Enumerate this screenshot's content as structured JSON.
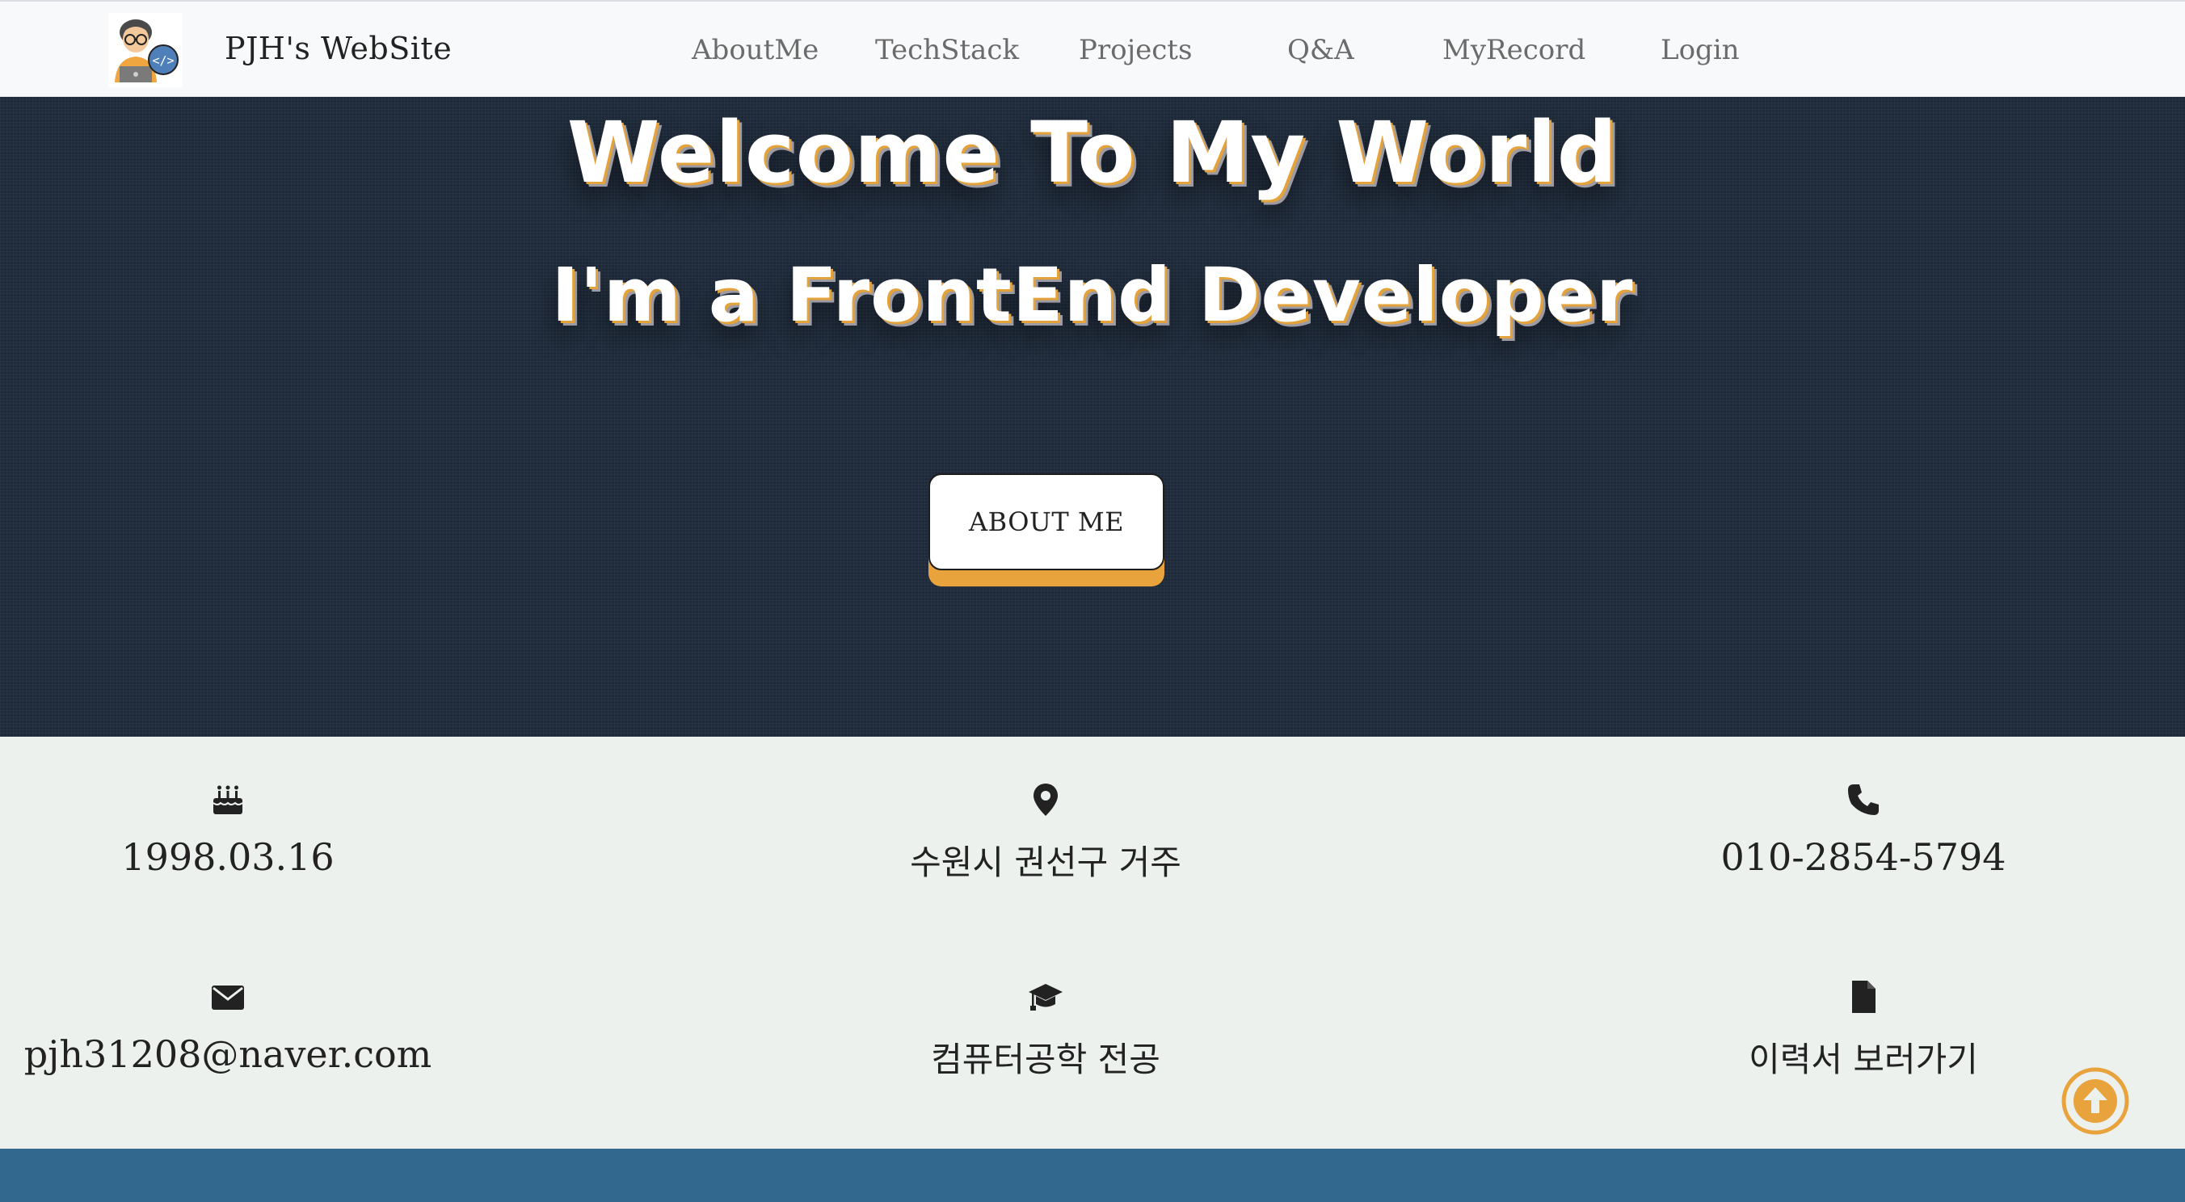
{
  "navbar": {
    "brand": "PJH's WebSite",
    "logo_icon": "developer-avatar-icon",
    "items": [
      "AboutMe",
      "TechStack",
      "Projects",
      "Q&A",
      "MyRecord",
      "Login"
    ]
  },
  "hero": {
    "title": "Welcome To My World",
    "subtitle": "I'm a FrontEnd Developer",
    "button_label": "ABOUT ME",
    "accent_color": "#e8a33c",
    "background_color": "#1e2a3a"
  },
  "info": {
    "birthday": {
      "icon": "birthday-cake-icon",
      "text": "1998.03.16"
    },
    "location": {
      "icon": "map-pin-icon",
      "text": "수원시 권선구 거주"
    },
    "phone": {
      "icon": "phone-icon",
      "text": "010-2854-5794"
    },
    "email": {
      "icon": "envelope-icon",
      "text": "pjh31208@naver.com"
    },
    "education": {
      "icon": "graduation-cap-icon",
      "text": "컴퓨터공학 전공"
    },
    "resume": {
      "icon": "file-icon",
      "text": "이력서 보러가기"
    }
  },
  "scroll_top": {
    "icon": "arrow-up-circle-icon",
    "color": "#e8a33c"
  },
  "footer_strip_color": "#33688e"
}
